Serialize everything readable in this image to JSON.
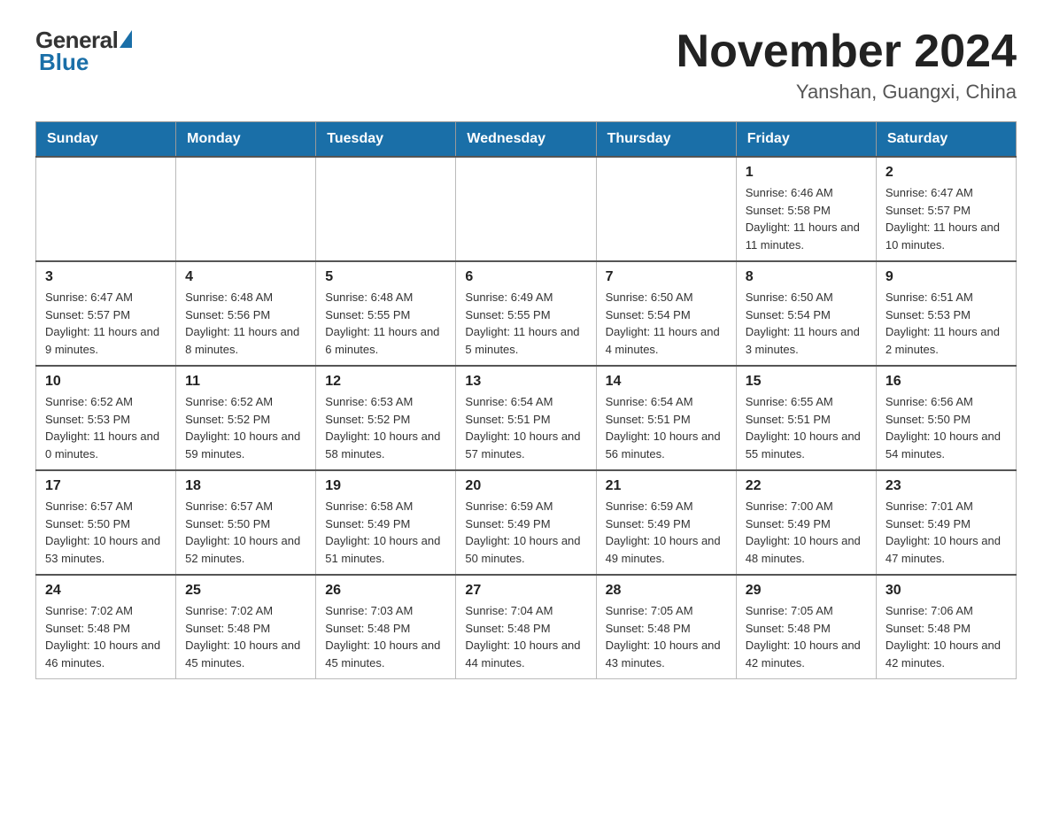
{
  "header": {
    "logo": {
      "general": "General",
      "blue": "Blue"
    },
    "title": "November 2024",
    "location": "Yanshan, Guangxi, China"
  },
  "days_of_week": [
    "Sunday",
    "Monday",
    "Tuesday",
    "Wednesday",
    "Thursday",
    "Friday",
    "Saturday"
  ],
  "weeks": [
    [
      {
        "day": "",
        "info": ""
      },
      {
        "day": "",
        "info": ""
      },
      {
        "day": "",
        "info": ""
      },
      {
        "day": "",
        "info": ""
      },
      {
        "day": "",
        "info": ""
      },
      {
        "day": "1",
        "info": "Sunrise: 6:46 AM\nSunset: 5:58 PM\nDaylight: 11 hours and 11 minutes."
      },
      {
        "day": "2",
        "info": "Sunrise: 6:47 AM\nSunset: 5:57 PM\nDaylight: 11 hours and 10 minutes."
      }
    ],
    [
      {
        "day": "3",
        "info": "Sunrise: 6:47 AM\nSunset: 5:57 PM\nDaylight: 11 hours and 9 minutes."
      },
      {
        "day": "4",
        "info": "Sunrise: 6:48 AM\nSunset: 5:56 PM\nDaylight: 11 hours and 8 minutes."
      },
      {
        "day": "5",
        "info": "Sunrise: 6:48 AM\nSunset: 5:55 PM\nDaylight: 11 hours and 6 minutes."
      },
      {
        "day": "6",
        "info": "Sunrise: 6:49 AM\nSunset: 5:55 PM\nDaylight: 11 hours and 5 minutes."
      },
      {
        "day": "7",
        "info": "Sunrise: 6:50 AM\nSunset: 5:54 PM\nDaylight: 11 hours and 4 minutes."
      },
      {
        "day": "8",
        "info": "Sunrise: 6:50 AM\nSunset: 5:54 PM\nDaylight: 11 hours and 3 minutes."
      },
      {
        "day": "9",
        "info": "Sunrise: 6:51 AM\nSunset: 5:53 PM\nDaylight: 11 hours and 2 minutes."
      }
    ],
    [
      {
        "day": "10",
        "info": "Sunrise: 6:52 AM\nSunset: 5:53 PM\nDaylight: 11 hours and 0 minutes."
      },
      {
        "day": "11",
        "info": "Sunrise: 6:52 AM\nSunset: 5:52 PM\nDaylight: 10 hours and 59 minutes."
      },
      {
        "day": "12",
        "info": "Sunrise: 6:53 AM\nSunset: 5:52 PM\nDaylight: 10 hours and 58 minutes."
      },
      {
        "day": "13",
        "info": "Sunrise: 6:54 AM\nSunset: 5:51 PM\nDaylight: 10 hours and 57 minutes."
      },
      {
        "day": "14",
        "info": "Sunrise: 6:54 AM\nSunset: 5:51 PM\nDaylight: 10 hours and 56 minutes."
      },
      {
        "day": "15",
        "info": "Sunrise: 6:55 AM\nSunset: 5:51 PM\nDaylight: 10 hours and 55 minutes."
      },
      {
        "day": "16",
        "info": "Sunrise: 6:56 AM\nSunset: 5:50 PM\nDaylight: 10 hours and 54 minutes."
      }
    ],
    [
      {
        "day": "17",
        "info": "Sunrise: 6:57 AM\nSunset: 5:50 PM\nDaylight: 10 hours and 53 minutes."
      },
      {
        "day": "18",
        "info": "Sunrise: 6:57 AM\nSunset: 5:50 PM\nDaylight: 10 hours and 52 minutes."
      },
      {
        "day": "19",
        "info": "Sunrise: 6:58 AM\nSunset: 5:49 PM\nDaylight: 10 hours and 51 minutes."
      },
      {
        "day": "20",
        "info": "Sunrise: 6:59 AM\nSunset: 5:49 PM\nDaylight: 10 hours and 50 minutes."
      },
      {
        "day": "21",
        "info": "Sunrise: 6:59 AM\nSunset: 5:49 PM\nDaylight: 10 hours and 49 minutes."
      },
      {
        "day": "22",
        "info": "Sunrise: 7:00 AM\nSunset: 5:49 PM\nDaylight: 10 hours and 48 minutes."
      },
      {
        "day": "23",
        "info": "Sunrise: 7:01 AM\nSunset: 5:49 PM\nDaylight: 10 hours and 47 minutes."
      }
    ],
    [
      {
        "day": "24",
        "info": "Sunrise: 7:02 AM\nSunset: 5:48 PM\nDaylight: 10 hours and 46 minutes."
      },
      {
        "day": "25",
        "info": "Sunrise: 7:02 AM\nSunset: 5:48 PM\nDaylight: 10 hours and 45 minutes."
      },
      {
        "day": "26",
        "info": "Sunrise: 7:03 AM\nSunset: 5:48 PM\nDaylight: 10 hours and 45 minutes."
      },
      {
        "day": "27",
        "info": "Sunrise: 7:04 AM\nSunset: 5:48 PM\nDaylight: 10 hours and 44 minutes."
      },
      {
        "day": "28",
        "info": "Sunrise: 7:05 AM\nSunset: 5:48 PM\nDaylight: 10 hours and 43 minutes."
      },
      {
        "day": "29",
        "info": "Sunrise: 7:05 AM\nSunset: 5:48 PM\nDaylight: 10 hours and 42 minutes."
      },
      {
        "day": "30",
        "info": "Sunrise: 7:06 AM\nSunset: 5:48 PM\nDaylight: 10 hours and 42 minutes."
      }
    ]
  ]
}
